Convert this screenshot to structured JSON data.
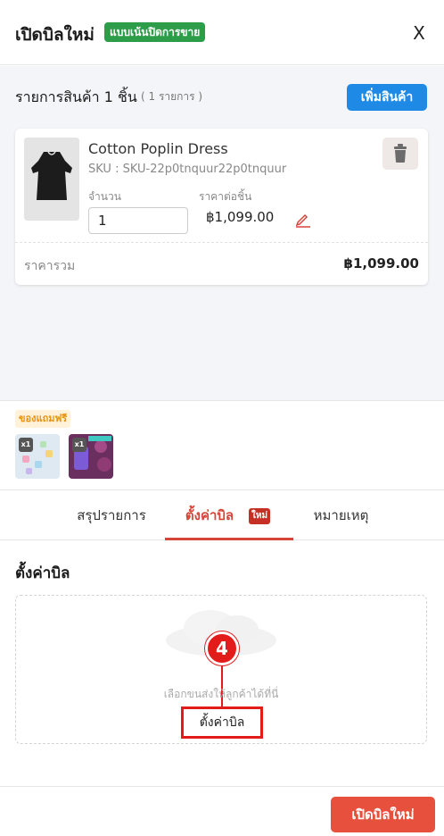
{
  "header": {
    "title": "เปิดบิลใหม่",
    "badge": "แบบเน้นปิดการขาย",
    "close_label": "X"
  },
  "product_list": {
    "title": "รายการสินค้า 1 ชิ้น",
    "count_label": "( 1 รายการ )",
    "add_button_label": "เพิ่มสินค้า"
  },
  "product": {
    "name": "Cotton Poplin Dress",
    "sku": "SKU : SKU-22p0tnquur22p0tnquur",
    "quantity_label": "จำนวน",
    "quantity_value": "1",
    "unit_price_label": "ราคาต่อชิ้น",
    "unit_price": "฿1,099.00",
    "total_label": "ราคารวม",
    "total_value": "฿1,099.00"
  },
  "gifts": {
    "label": "ของแถมฟรี",
    "items": [
      {
        "qty": "x1",
        "icon": "gift-product-pastel-icon"
      },
      {
        "qty": "x1",
        "icon": "gift-product-purple-icon"
      }
    ]
  },
  "tabs": [
    {
      "label": "สรุปรายการ",
      "active": false
    },
    {
      "label": "ตั้งค่าบิล",
      "active": true,
      "badge": "ใหม่"
    },
    {
      "label": "หมายเหตุ",
      "active": false
    }
  ],
  "bill_settings": {
    "title": "ตั้งค่าบิล",
    "hint": "เลือกขนส่งให้ลูกค้าได้ที่นี่",
    "config_link": "ตั้งค่าบิล",
    "step_number": "4"
  },
  "footer": {
    "open_bill_label": "เปิดบิลใหม่"
  },
  "colors": {
    "primary_blue": "#1f8ae6",
    "accent_red": "#d6453a",
    "badge_green": "#2e9d4a",
    "annotation_red": "#e31b1b",
    "footer_button": "#e8503e"
  }
}
